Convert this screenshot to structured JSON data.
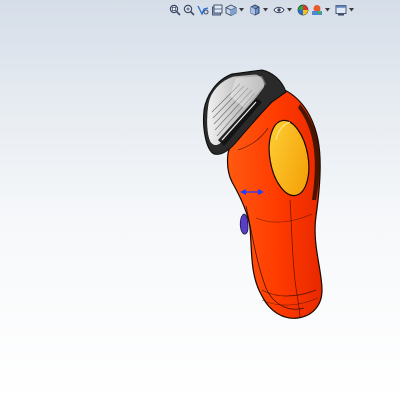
{
  "app": {
    "view": "graphics-area",
    "background": {
      "top": "#d5dde8",
      "bottom": "#ffffff"
    }
  },
  "heads_up_toolbar": {
    "buttons": [
      {
        "id": "zoom-to-fit",
        "icon": "zoom-to-fit-icon",
        "dropdown": false
      },
      {
        "id": "zoom-to-area",
        "icon": "zoom-to-area-icon",
        "dropdown": false
      },
      {
        "id": "previous-view",
        "icon": "previous-view-icon",
        "dropdown": false
      },
      {
        "id": "section-view",
        "icon": "section-view-icon",
        "dropdown": false
      },
      {
        "id": "view-orientation",
        "icon": "view-orientation-icon",
        "dropdown": true
      },
      {
        "id": "display-style",
        "icon": "display-style-icon",
        "dropdown": true
      },
      {
        "id": "hide-show-items",
        "icon": "hide-show-items-icon",
        "dropdown": true
      },
      {
        "id": "edit-appearance",
        "icon": "edit-appearance-icon",
        "dropdown": false
      },
      {
        "id": "apply-scene",
        "icon": "apply-scene-icon",
        "dropdown": true
      },
      {
        "id": "view-settings",
        "icon": "view-settings-icon",
        "dropdown": true
      }
    ]
  },
  "model": {
    "name": "electric-shaver",
    "colors": {
      "body": "#ff3c00",
      "body_outline": "#1a0800",
      "grip_panel": "#ffb000",
      "head_frame": "#2a2a2a",
      "foil": "#d9d9d9",
      "button": "#5a3ec8",
      "triad_arrow": "#1e3cff"
    }
  }
}
